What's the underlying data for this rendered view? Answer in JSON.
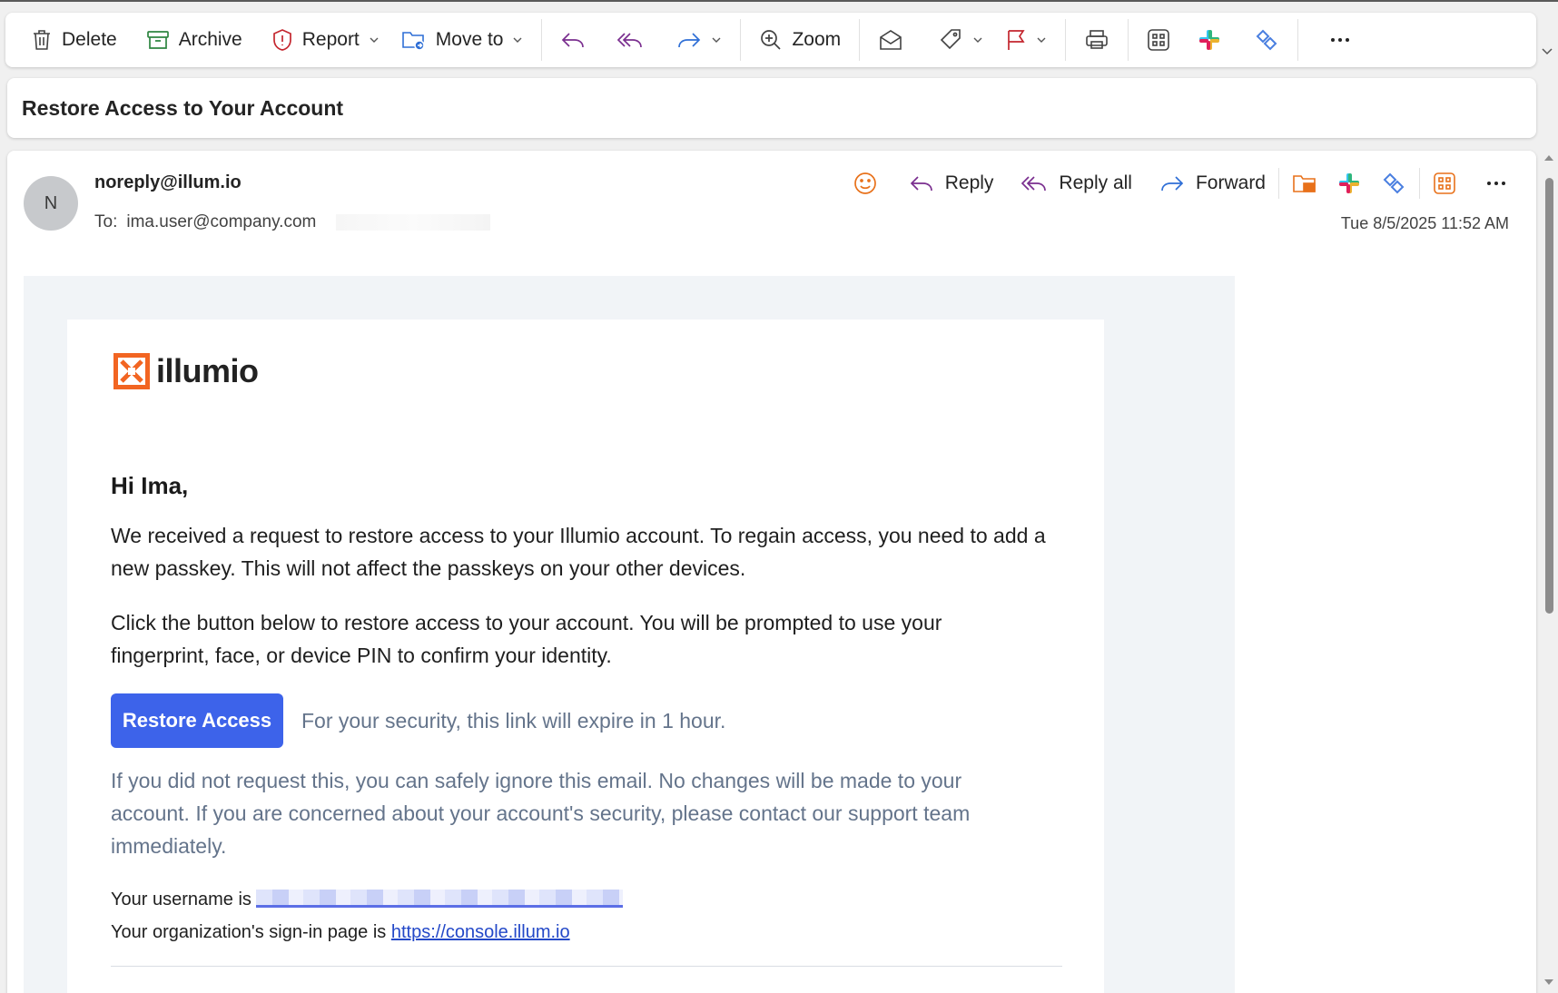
{
  "toolbar": {
    "delete_label": "Delete",
    "archive_label": "Archive",
    "report_label": "Report",
    "move_label": "Move to",
    "zoom_label": "Zoom"
  },
  "subject": "Restore Access to Your Account",
  "message": {
    "avatar_initial": "N",
    "sender": "noreply@illum.io",
    "to_label": "To:",
    "to_address": "ima.user@company.com",
    "date": "Tue 8/5/2025 11:52 AM",
    "actions": {
      "reply": "Reply",
      "reply_all": "Reply all",
      "forward": "Forward"
    }
  },
  "email": {
    "logo_text": "illumio",
    "greeting": "Hi Ima,",
    "para1": "We received a request to restore access to your Illumio account. To regain access, you need to add a new passkey. This will not affect the passkeys on your other devices.",
    "para2": "Click the button below to restore access to your account. You will be prompted to use your fingerprint, face, or device PIN to confirm your identity.",
    "button_label": "Restore Access",
    "expire_note": "For your security, this link will expire in 1 hour.",
    "para3": "If you did not request this, you can safely ignore this email. No changes will be made to your account. If you are concerned about your account's security, please contact our support team immediately.",
    "username_prefix": "Your username is",
    "signin_prefix": "Your organization's sign-in page is",
    "signin_url": "https://console.illum.io"
  },
  "colors": {
    "button": "#3d63ea",
    "link": "#2348c8",
    "muted_text": "#64748b",
    "logo_orange": "#f26522",
    "email_background": "#f1f4f7"
  }
}
